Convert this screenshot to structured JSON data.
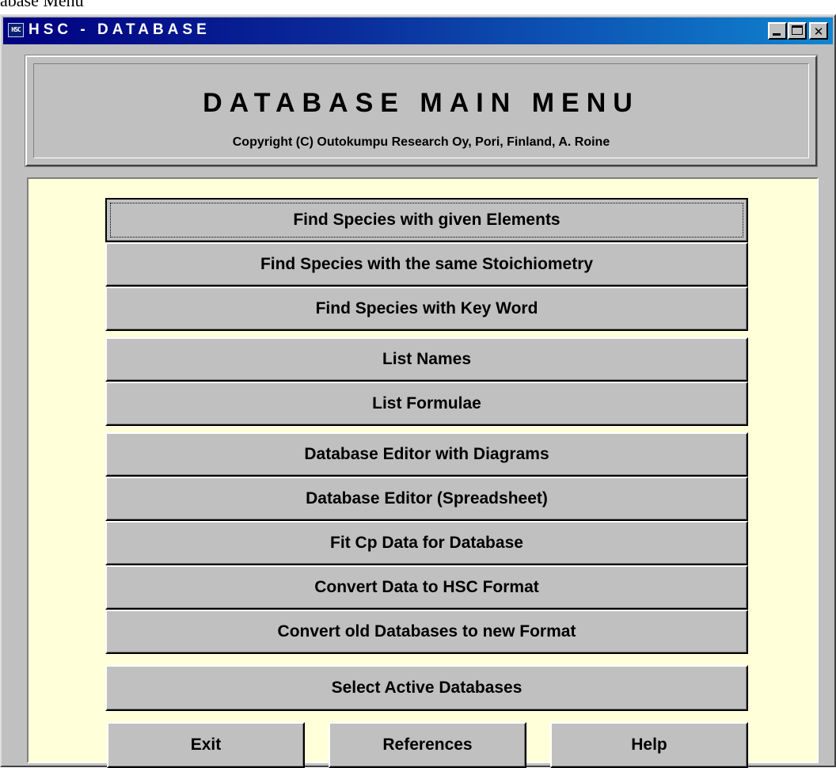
{
  "page_heading": "abase Menu",
  "window": {
    "icon_text": "HSC",
    "title": "HSC - DATABASE",
    "controls": {
      "minimize": "minimize",
      "maximize": "maximize",
      "close": "✕"
    }
  },
  "header": {
    "title": "DATABASE MAIN MENU",
    "copyright": "Copyright (C) Outokumpu Research Oy, Pori, Finland, A. Roine"
  },
  "menu": {
    "groups": [
      [
        "Find Species with given Elements",
        "Find Species with the same Stoichiometry",
        "Find Species with Key Word"
      ],
      [
        "List Names",
        "List Formulae"
      ],
      [
        "Database Editor with Diagrams",
        "Database Editor (Spreadsheet)",
        "Fit Cp Data for Database",
        "Convert Data to HSC Format",
        "Convert old Databases to new Format"
      ],
      [
        "Select Active Databases"
      ]
    ],
    "focused_item": "Find Species with given Elements",
    "bottom_buttons": [
      "Exit",
      "References",
      "Help"
    ]
  },
  "colors": {
    "menu_background": "#ffffd9",
    "title_bar_start": "#000080",
    "title_bar_end": "#1084d0",
    "face": "#c0c0c0"
  }
}
